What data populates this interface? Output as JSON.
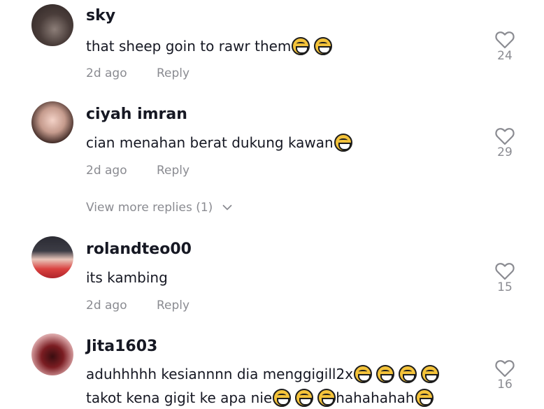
{
  "comments": [
    {
      "username": "sky",
      "text": "that sheep goin to rawr them",
      "emojis": [
        "joy-emoji",
        "joy-emoji"
      ],
      "time": "2d ago",
      "reply_label": "Reply",
      "likes": "24"
    },
    {
      "username": "ciyah imran",
      "text": "cian menahan berat dukung kawan",
      "emojis": [
        "sweat-smile-emoji"
      ],
      "time": "2d ago",
      "reply_label": "Reply",
      "likes": "29"
    },
    {
      "username": "rolandteo00",
      "text": "its kambing",
      "time": "2d ago",
      "reply_label": "Reply",
      "likes": "15"
    },
    {
      "username": "Jita1603",
      "text_line1": "aduhhhhh kesiannnn dia menggigill2x",
      "text_line2a": "takot kena gigit ke apa nie",
      "text_line2b": "hahahahah",
      "emojis": [
        "joy-emoji",
        "joy-emoji",
        "joy-emoji",
        "joy-emoji"
      ],
      "likes": "16"
    }
  ],
  "view_more_replies": "View more replies (1)",
  "icons": {
    "like": "heart-outline-icon",
    "expand": "chevron-down-icon"
  },
  "colors": {
    "text": "#161823",
    "muted": "#8a8b91",
    "emoji": "#f4c33a"
  }
}
